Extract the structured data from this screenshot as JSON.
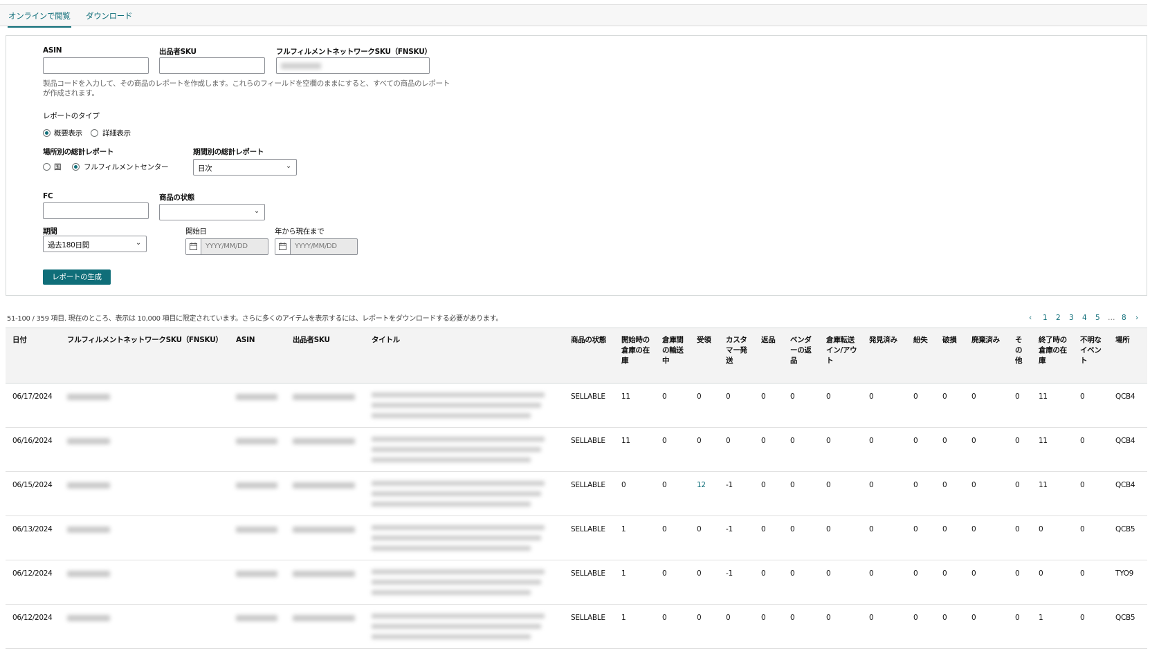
{
  "tabs": {
    "online": "オンラインで閲覧",
    "download": "ダウンロード"
  },
  "filters": {
    "asin_label": "ASIN",
    "sku_label": "出品者SKU",
    "fnsku_label": "フルフィルメントネットワークSKU（FNSKU）",
    "help_text": "製品コードを入力して、その商品のレポートを作成します。これらのフィールドを空欄のままにすると、すべての商品のレポートが作成されます。",
    "report_type_label": "レポートのタイプ",
    "report_type_summary": "概要表示",
    "report_type_detail": "詳細表示",
    "location_label": "場所別の総計レポート",
    "location_country": "国",
    "location_fc": "フルフィルメントセンター",
    "period_report_label": "期間別の総計レポート",
    "period_report_value": "日次",
    "fc_label": "FC",
    "condition_label": "商品の状態",
    "condition_value": "",
    "period_label": "期間",
    "period_value": "過去180日間",
    "start_label": "開始日",
    "start_placeholder": "YYYY/MM/DD",
    "ytd_label": "年から現在まで",
    "ytd_placeholder": "YYYY/MM/DD",
    "generate_button": "レポートの生成"
  },
  "summary_text": "51-100 / 359 項目. 現在のところ、表示は 10,000 項目に限定されています。さらに多くのアイテムを表示するには、レポートをダウンロードする必要があります。",
  "pager": {
    "prev": "‹",
    "pages": [
      "1",
      "2",
      "3",
      "4",
      "5"
    ],
    "ellipsis": "…",
    "last": "8",
    "next": "›"
  },
  "table": {
    "headers": [
      "日付",
      "フルフィルメントネットワークSKU（FNSKU）",
      "ASIN",
      "出品者SKU",
      "タイトル",
      "商品の状態",
      "開始時の倉庫の在庫",
      "倉庫間の輸送中",
      "受領",
      "カスタマー発送",
      "返品",
      "ベンダーの返品",
      "倉庫転送イン/アウト",
      "発見済み",
      "紛失",
      "破損",
      "廃棄済み",
      "その他",
      "終了時の倉庫の在庫",
      "不明なイベント",
      "場所"
    ],
    "rows": [
      [
        "06/17/2024",
        "SELLABLE",
        "11",
        "0",
        "0",
        "0",
        "0",
        "0",
        "0",
        "0",
        "0",
        "0",
        "0",
        "0",
        "11",
        "0",
        "QCB4"
      ],
      [
        "06/16/2024",
        "SELLABLE",
        "11",
        "0",
        "0",
        "0",
        "0",
        "0",
        "0",
        "0",
        "0",
        "0",
        "0",
        "0",
        "11",
        "0",
        "QCB4"
      ],
      [
        "06/15/2024",
        "SELLABLE",
        "0",
        "0",
        "12",
        "-1",
        "0",
        "0",
        "0",
        "0",
        "0",
        "0",
        "0",
        "0",
        "11",
        "0",
        "QCB4"
      ],
      [
        "06/13/2024",
        "SELLABLE",
        "1",
        "0",
        "0",
        "-1",
        "0",
        "0",
        "0",
        "0",
        "0",
        "0",
        "0",
        "0",
        "0",
        "0",
        "QCB5"
      ],
      [
        "06/12/2024",
        "SELLABLE",
        "1",
        "0",
        "0",
        "-1",
        "0",
        "0",
        "0",
        "0",
        "0",
        "0",
        "0",
        "0",
        "0",
        "0",
        "TYO9"
      ],
      [
        "06/12/2024",
        "SELLABLE",
        "1",
        "0",
        "0",
        "0",
        "0",
        "0",
        "0",
        "0",
        "0",
        "0",
        "0",
        "0",
        "1",
        "0",
        "QCB5"
      ]
    ]
  }
}
